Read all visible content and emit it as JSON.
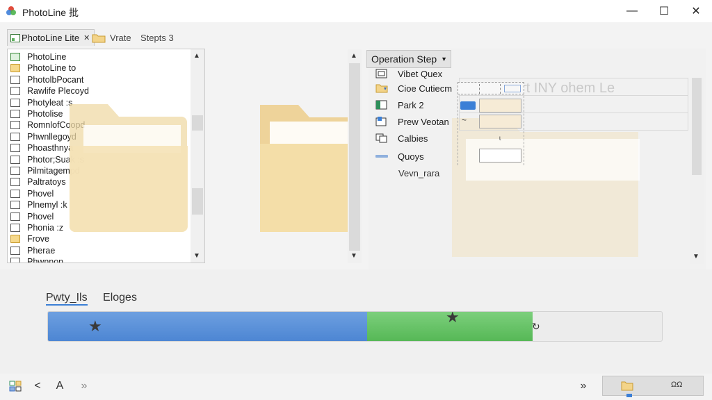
{
  "window": {
    "title": "PhotoLine 批",
    "minimize_glyph": "—",
    "maximize_glyph": "☐",
    "close_glyph": "✕"
  },
  "tabs": [
    {
      "label": "PhotoLine Lite",
      "close": "✕"
    },
    {
      "label": "Vrate"
    },
    {
      "label": "Stepts 3"
    }
  ],
  "file_list": [
    {
      "label": "PhotoLine",
      "icon": "green"
    },
    {
      "label": "PhotoLine to",
      "icon": "folder"
    },
    {
      "label": "PhotolbPocant",
      "icon": "file"
    },
    {
      "label": "Rawlife Plecoyd",
      "icon": "file"
    },
    {
      "label": "Photyleat :s",
      "icon": "file"
    },
    {
      "label": "Photolise",
      "icon": "file"
    },
    {
      "label": "RomnlofCoopd",
      "icon": "file"
    },
    {
      "label": "Phwnllegoyd",
      "icon": "file"
    },
    {
      "label": "Phoasthnya",
      "icon": "file"
    },
    {
      "label": "Photor;Suak :s",
      "icon": "file"
    },
    {
      "label": "Pilmitagempd",
      "icon": "file"
    },
    {
      "label": "Paltratoys",
      "icon": "file"
    },
    {
      "label": "Phovel",
      "icon": "file"
    },
    {
      "label": "Plnemyl :k",
      "icon": "file"
    },
    {
      "label": "Phovel",
      "icon": "file"
    },
    {
      "label": "Phonia :z",
      "icon": "file"
    },
    {
      "label": "Frove",
      "icon": "folder"
    },
    {
      "label": "Pherae",
      "icon": "file"
    },
    {
      "label": "Phwnnon",
      "icon": "file"
    }
  ],
  "operation": {
    "button_label": "Operation Step",
    "items": [
      {
        "label": "Vibet Quex",
        "icon": "frame-icon"
      },
      {
        "label": "Cioe Cutiecm",
        "icon": "folder-icon"
      },
      {
        "label": "Park 2",
        "icon": "layers-icon"
      },
      {
        "label": "Prew Veotan",
        "icon": "preview-icon"
      },
      {
        "label": "Calbies",
        "icon": "copy-icon"
      },
      {
        "label": "Quoys",
        "icon": "bar-icon"
      }
    ],
    "footer_label": "Vevn_rara",
    "cell_tilde": "~",
    "cell_dot": "ɩ"
  },
  "ghost_text": "rt INY ohem Le",
  "progress": {
    "tab_a": "Pwty_Ils",
    "tab_b": "Eloges",
    "blue_fraction": 0.52,
    "green_fraction": 0.27,
    "end_glyph": "↻"
  },
  "bottom": {
    "back_glyph": "<",
    "text_glyph": "A",
    "forward_glyph": "»",
    "right_glyph": "»",
    "right_box_label": "ΩΩ"
  }
}
